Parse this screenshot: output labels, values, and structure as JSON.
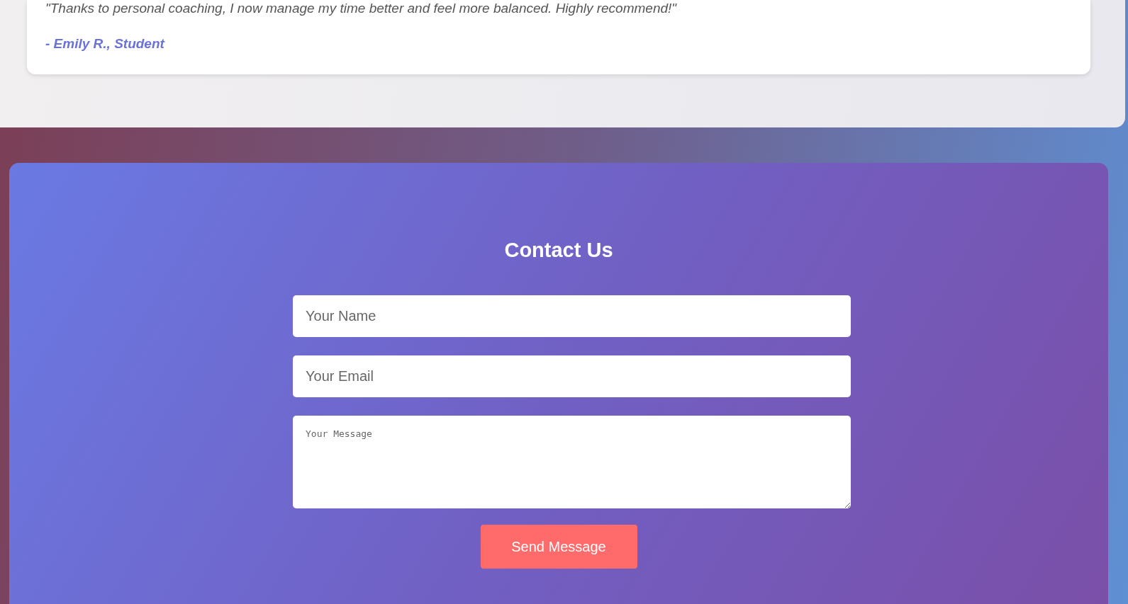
{
  "testimonial": {
    "quote": "\"Thanks to personal coaching, I now manage my time better and feel more balanced. Highly recommend!\"",
    "author": "- Emily R., Student"
  },
  "contact": {
    "title": "Contact Us",
    "fields": [
      {
        "kind": "input",
        "placeholder": "Your Name"
      },
      {
        "kind": "input",
        "placeholder": "Your Email"
      },
      {
        "kind": "textarea",
        "placeholder": "Your Message"
      }
    ],
    "button": "Send Message"
  }
}
